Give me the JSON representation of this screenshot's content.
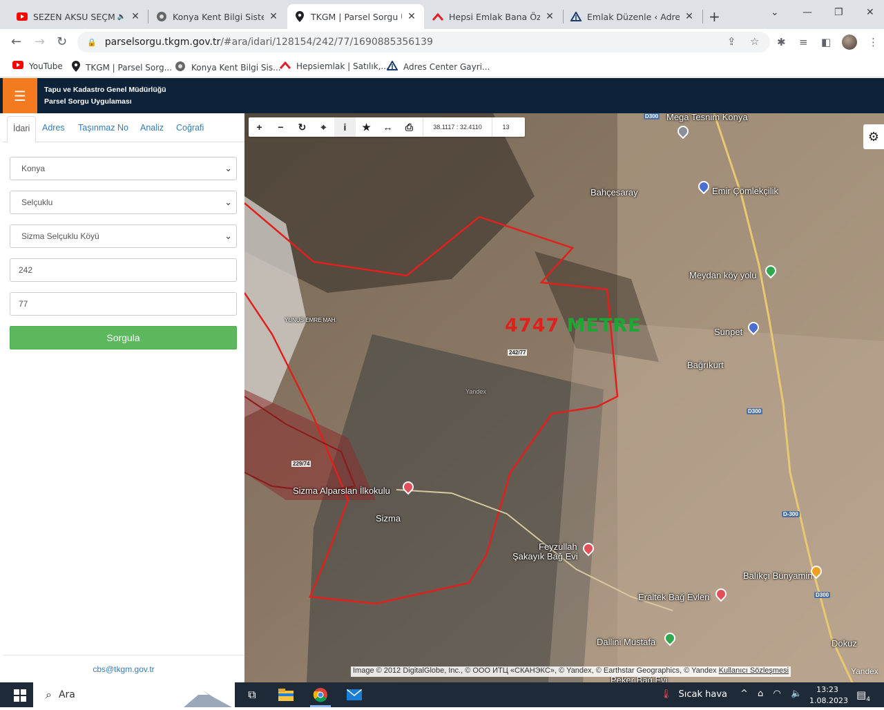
{
  "browser": {
    "tabs": [
      {
        "title": "SEZEN AKSU SEÇME ŞARKILAR",
        "favicon": "youtube-icon",
        "audio": true
      },
      {
        "title": "Konya Kent Bilgi Sistemi",
        "favicon": "konya-logo-icon"
      },
      {
        "title": "TKGM | Parsel Sorgu Uygulaması",
        "favicon": "location-pin-icon",
        "active": true
      },
      {
        "title": "Hepsi Emlak Bana Özel",
        "favicon": "hepsiemlak-icon"
      },
      {
        "title": "Emlak Düzenle ‹ Adres Center",
        "favicon": "adres-center-icon"
      }
    ],
    "url_host": "parselsorgu.tkgm.gov.tr",
    "url_path": "/#ara/idari/128154/242/77/1690885356139",
    "bookmarks": [
      {
        "label": "YouTube",
        "favicon": "youtube-icon"
      },
      {
        "label": "TKGM | Parsel Sorg...",
        "favicon": "location-pin-icon"
      },
      {
        "label": "Konya Kent Bilgi Sis...",
        "favicon": "konya-logo-icon"
      },
      {
        "label": "Hepsiemlak | Satılık,...",
        "favicon": "hepsiemlak-icon"
      },
      {
        "label": "Adres Center Gayri...",
        "favicon": "adres-center-icon"
      }
    ]
  },
  "app": {
    "title_line1": "Tapu ve Kadastro Genel Müdürlüğü",
    "title_line2": "Parsel Sorgu Uygulaması",
    "accent": "#f47a20",
    "header_bg": "#0b2238"
  },
  "sidebar": {
    "tabs": [
      "İdari",
      "Adres",
      "Taşınmaz No",
      "Analiz",
      "Coğrafi"
    ],
    "active_tab": "İdari",
    "province": "Konya",
    "district": "Selçuklu",
    "neighborhood": "Sizma Selçuklu Köyü",
    "block": "242",
    "parcel": "77",
    "submit_label": "Sorgula",
    "footer_email": "cbs@tkgm.gov.tr"
  },
  "map": {
    "coordinates": "38.1117 : 32.4110",
    "zoom": "13",
    "measure_value": "4747",
    "measure_unit": "METRE",
    "parcel_labels": [
      "242/77",
      "229/74"
    ],
    "places": [
      "Mega Tesnim Konya",
      "Bahçesaray",
      "Emir Çömlekçilik",
      "Meydan köy yolu",
      "Sunpet",
      "Bağrıkurt",
      "Sizma Alparslan İlkokulu",
      "Sizma",
      "Feyzullah",
      "Şakayık Bağ Evi",
      "Balıkçı Bünyamin",
      "Eraltek Bağ Evleri",
      "Dallini Mustafa",
      "Dokuz",
      "Peker Bağ Evi",
      "YUNUS EMRE MAH."
    ],
    "roads": [
      "D300",
      "D300",
      "D300",
      "D-300"
    ],
    "attribution": "Image © 2012 DigitalGlobe, Inc., © ООО ИТЦ «СКАНЭКС», © Yandex, © Earthstar Geographics, © Yandex",
    "license_link": "Kullanıcı Sözleşmesi",
    "provider": "Yandex",
    "watermark": "Yandex"
  },
  "taskbar": {
    "search_placeholder": "Ara",
    "weather": "Sıcak hava",
    "time": "13:23",
    "date": "1.08.2023",
    "notification_count": "4"
  }
}
